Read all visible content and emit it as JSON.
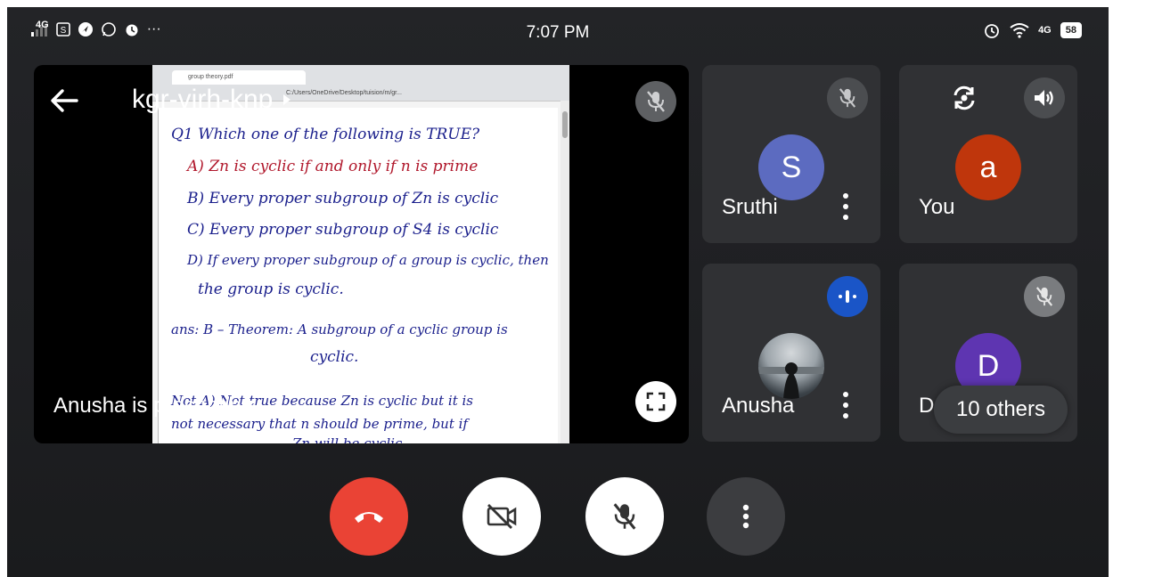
{
  "status_bar": {
    "network_label": "4G",
    "time": "7:07 PM",
    "more_dots": "···",
    "right_network": "4G",
    "battery": "58"
  },
  "meeting": {
    "code": "kgr-virh-knp",
    "presenting_label": "Anusha is presenting",
    "others_label": "10 others"
  },
  "document": {
    "tab_title": "group theory.pdf",
    "address": "C:/Users/OneDrive/Desktop/tuision/m/gr...",
    "lines": [
      "Q1  Which one of the following is TRUE?",
      "A) Zn is cyclic if and only if n is prime",
      "B) Every proper subgroup of Zn is cyclic",
      "C) Every proper subgroup of S4 is cyclic",
      "D) If every proper subgroup of a group is cyclic, then",
      "the group is cyclic.",
      "ans: B  – Theorem: A subgroup of a cyclic group is",
      "cyclic.",
      "Not A) Not true because Zn is cyclic but it is",
      "not necessary that n should be prime, but if",
      "Zn will be cyclic."
    ]
  },
  "participants": [
    {
      "name": "Sruthi",
      "initial": "S",
      "color": "#5c6bc0",
      "muted": true
    },
    {
      "name": "You",
      "initial": "a",
      "color": "#bf360c",
      "muted": false
    },
    {
      "name": "Anusha",
      "initial": "",
      "color": "#4a5560",
      "speaking": true
    },
    {
      "name": "Dr. ",
      "initial": "D",
      "color": "#5e35b1",
      "muted": true
    }
  ],
  "colors": {
    "end_call": "#ea4335",
    "speaking_badge": "#1a55c7",
    "control_light": "#ffffff",
    "control_dark": "#3c3d40"
  }
}
